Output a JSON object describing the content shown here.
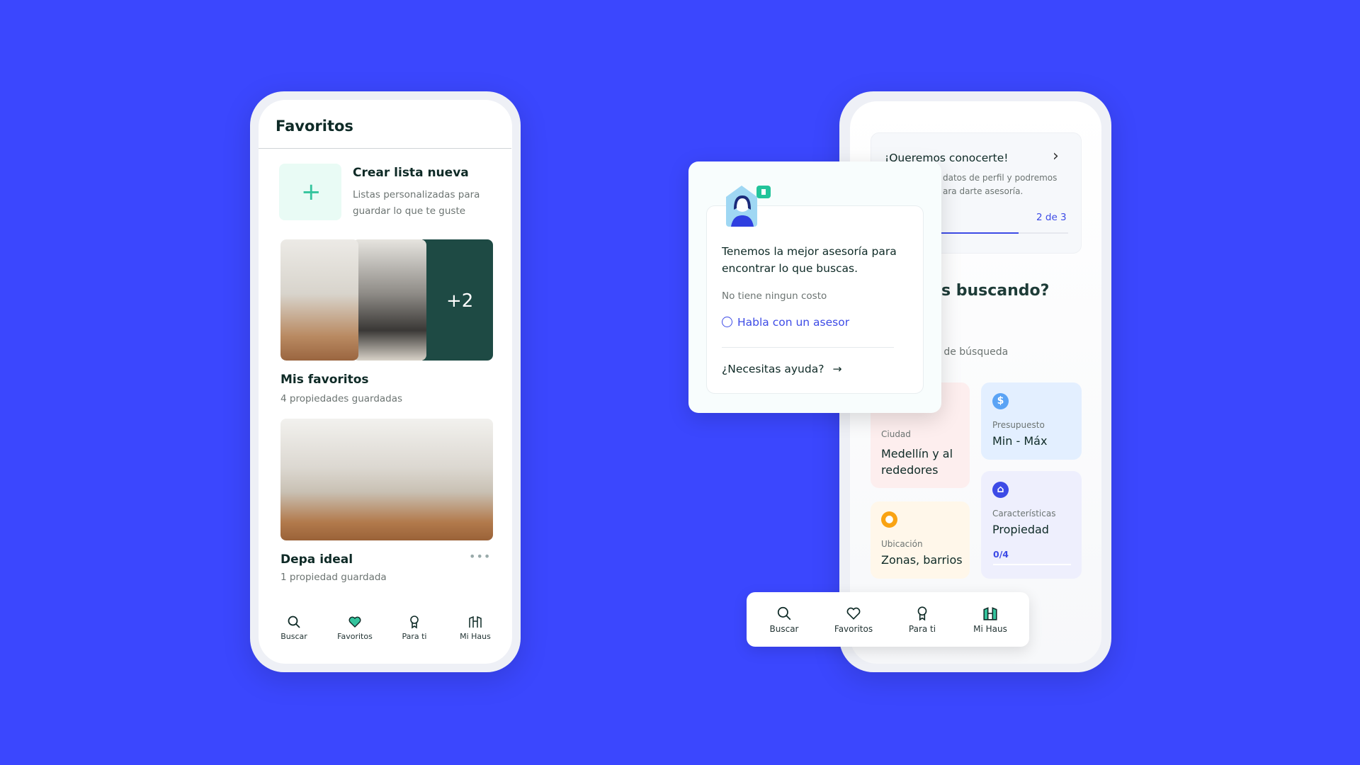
{
  "favorites_screen": {
    "title": "Favoritos",
    "create_list": {
      "title": "Crear lista nueva",
      "description_line1": "Listas personalizadas para",
      "description_line2": "guardar lo que te guste",
      "icon": "plus-icon"
    },
    "lists": [
      {
        "name": "Mis favoritos",
        "count": "4 propiedades guardadas",
        "extra_photos": "+2"
      },
      {
        "name": "Depa ideal",
        "count": "1 propiedad guardada",
        "menu_icon": "more-horizontal-icon"
      }
    ],
    "nav": [
      {
        "label": "Buscar",
        "icon": "search-icon"
      },
      {
        "label": "Favoritos",
        "icon": "heart-icon",
        "active": true
      },
      {
        "label": "Para ti",
        "icon": "award-icon"
      },
      {
        "label": "Mi Haus",
        "icon": "building-icon"
      }
    ]
  },
  "mihaus_screen": {
    "profile_card": {
      "title": "¡Queremos conocerte!",
      "line1": "datos de perfil y podremos",
      "line2": "ara darte asesoría.",
      "step": "2 de 3",
      "progress": 0.67
    },
    "heading": "s buscando?",
    "subheading": "l de búsqueda",
    "filters": [
      {
        "label": "Ciudad",
        "value_line1": "Medellín y al",
        "value_line2": "rededores",
        "bg": "#fdeeee"
      },
      {
        "label": "Presupuesto",
        "value": "Min - Máx",
        "icon": "dollar-icon",
        "bg": "#e3efff"
      },
      {
        "label": "Ubicación",
        "value": "Zonas, barrios",
        "icon": "location-pin-icon",
        "bg": "#fff7ea"
      },
      {
        "label": "Características",
        "value": "Propiedad",
        "progress": "0/4",
        "icon": "home-icon",
        "bg": "#eeeffd"
      }
    ],
    "nav": [
      {
        "label": "Buscar",
        "icon": "search-icon"
      },
      {
        "label": "Favoritos",
        "icon": "heart-icon"
      },
      {
        "label": "Para ti",
        "icon": "award-icon"
      },
      {
        "label": "Mi Haus",
        "icon": "building-icon",
        "active": true
      }
    ]
  },
  "advisor_popup": {
    "message_line1": "Tenemos la mejor asesoría para",
    "message_line2": "encontrar lo que buscas.",
    "note": "No tiene ningun costo",
    "cta": "Habla con un asesor",
    "help": "¿Necesitas ayuda?"
  },
  "colors": {
    "background": "#3b47fe",
    "accent_green": "#34c49d",
    "link_blue": "#3d4be6",
    "text_dark": "#0e2a26"
  }
}
